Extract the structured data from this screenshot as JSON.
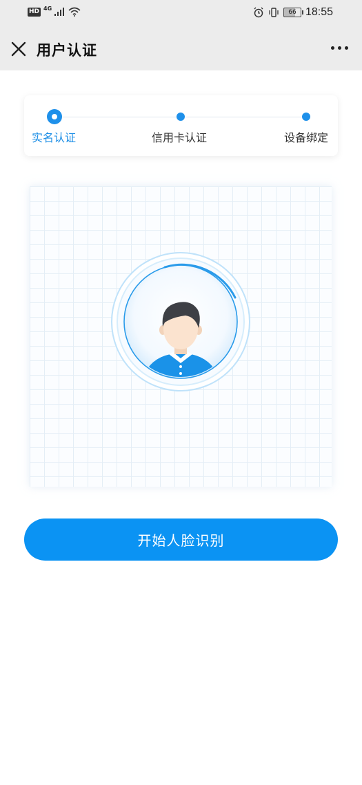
{
  "status_bar": {
    "hd": "HD",
    "network": "4G",
    "time": "18:55",
    "battery": "66"
  },
  "header": {
    "title": "用户认证"
  },
  "steps": [
    {
      "label": "实名认证",
      "active": true
    },
    {
      "label": "信用卡认证",
      "active": false
    },
    {
      "label": "设备绑定",
      "active": false
    }
  ],
  "face_capture": {
    "icon": "user-avatar-icon"
  },
  "start_button": {
    "label": "开始人脸识别"
  },
  "colors": {
    "accent": "#0b93f3",
    "header_bg": "#ececec"
  }
}
